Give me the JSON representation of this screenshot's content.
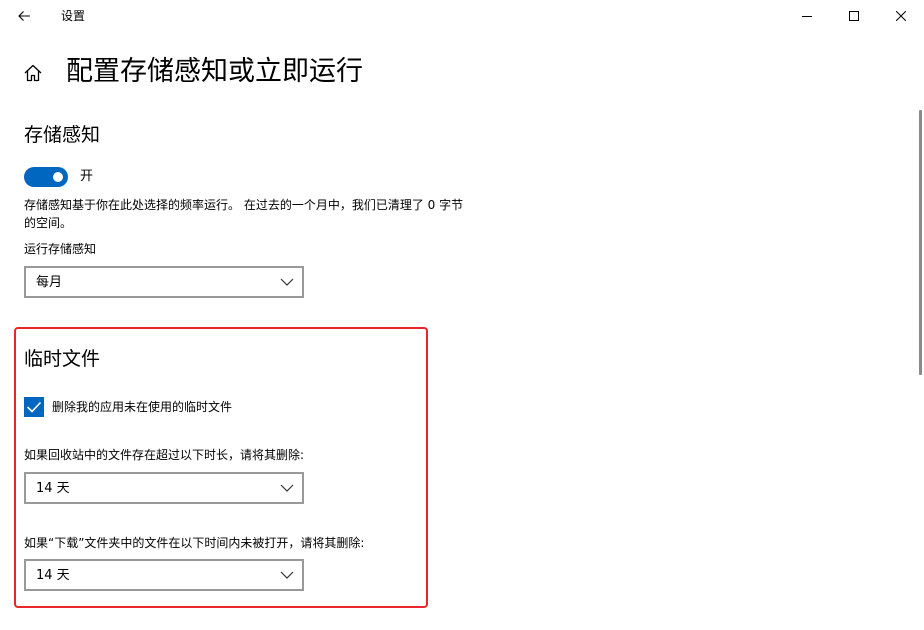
{
  "window": {
    "title": "设置"
  },
  "page": {
    "title": "配置存储感知或立即运行"
  },
  "storage_sense": {
    "section_title": "存储感知",
    "toggle_state_label": "开",
    "toggle_on": true,
    "description": "存储感知基于你在此处选择的频率运行。 在过去的一个月中，我们已清理了 0 字节 的空间。",
    "run_label": "运行存储感知",
    "run_value": "每月"
  },
  "temp_files": {
    "section_title": "临时文件",
    "delete_temp_label": "删除我的应用未在使用的临时文件",
    "delete_temp_checked": true,
    "recycle_label": "如果回收站中的文件存在超过以下时长，请将其删除:",
    "recycle_value": "14 天",
    "downloads_label": "如果“下载”文件夹中的文件在以下时间内未被打开，请将其删除:",
    "downloads_value": "14 天"
  },
  "colors": {
    "accent": "#0067c0",
    "highlight": "#e8262b",
    "dropdown_border": "#999999"
  },
  "icons": {
    "back": "back-arrow-icon",
    "home": "home-icon",
    "minimize": "minimize-icon",
    "maximize": "maximize-icon",
    "close": "close-icon",
    "chevron": "chevron-down-icon",
    "check": "checkmark-icon"
  }
}
